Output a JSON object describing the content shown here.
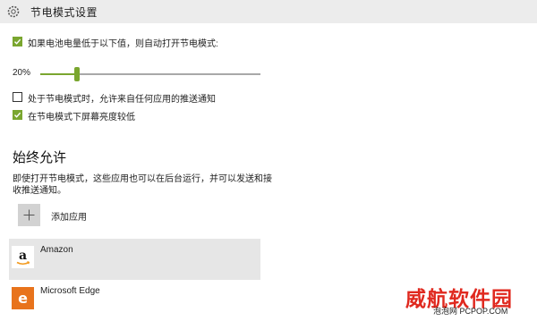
{
  "header": {
    "title": "节电模式设置",
    "icon": "gear-icon"
  },
  "battery_saver": {
    "auto_enable_label": "如果电池电量低于以下值，则自动打开节电模式:",
    "auto_enable_checked": true,
    "threshold_label": "20%",
    "threshold_value_percent": 20,
    "allow_push_label": "处于节电模式时，允许来自任何应用的推送通知",
    "allow_push_checked": false,
    "lower_brightness_label": "在节电模式下屏幕亮度较低",
    "lower_brightness_checked": true
  },
  "always_allowed": {
    "title": "始终允许",
    "description": "即使打开节电模式，这些应用也可以在后台运行，并可以发送和接收推送通知。",
    "add_app_label": "添加应用",
    "add_icon": "plus-icon",
    "apps": [
      {
        "name": "Amazon",
        "icon": "amazon-icon",
        "selected": true
      },
      {
        "name": "Microsoft Edge",
        "icon": "edge-icon",
        "selected": false
      }
    ]
  },
  "watermark": {
    "main": "威航软件园",
    "sub": "泡泡网 PCPOP.COM"
  },
  "colors": {
    "accent": "#7aa62f",
    "header_bg": "#ececec",
    "selected_row": "#e6e6e6",
    "edge_orange": "#e8731c",
    "watermark_red": "#e0291f"
  }
}
